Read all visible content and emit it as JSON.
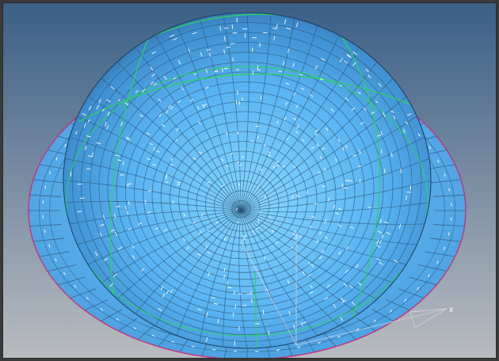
{
  "viewport": {
    "background_top": "#3b5f86",
    "background_bottom": "#b9bcc0",
    "mesh_color": "#5ab4f2",
    "mesh_line_color": "#2a5478",
    "feature_edge_color": "#29d65a",
    "free_edge_color": "#c8307a",
    "normal_marker_color": "#ffffff"
  },
  "triad": {
    "x_label": "x",
    "y_label": "y",
    "z_label": "z"
  },
  "icons": {
    "triad": "axis-triad-icon"
  }
}
